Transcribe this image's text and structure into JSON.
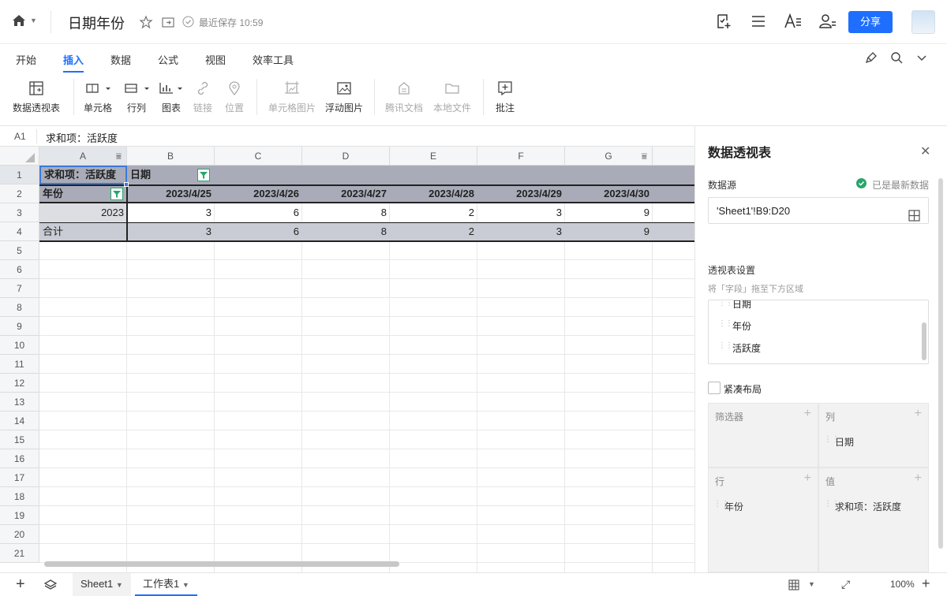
{
  "header": {
    "title": "日期年份",
    "save_status": "最近保存 10:59",
    "share_label": "分享"
  },
  "menu": {
    "tabs": [
      "开始",
      "插入",
      "数据",
      "公式",
      "视图",
      "效率工具"
    ]
  },
  "toolbar": {
    "items": [
      "数据透视表",
      "单元格",
      "行列",
      "图表",
      "链接",
      "位置",
      "单元格图片",
      "浮动图片",
      "腾讯文档",
      "本地文件",
      "批注"
    ]
  },
  "formula": {
    "cell_ref": "A1",
    "value": "求和项：活跃度"
  },
  "grid": {
    "columns": [
      "A",
      "B",
      "C",
      "D",
      "E",
      "F",
      "G"
    ],
    "rows": [
      "1",
      "2",
      "3",
      "4",
      "5",
      "6",
      "7",
      "8",
      "9",
      "10",
      "11",
      "12",
      "13",
      "14",
      "15",
      "16",
      "17",
      "18",
      "19",
      "20",
      "21"
    ],
    "r1": {
      "a": "求和项：活跃度",
      "b": "日期"
    },
    "r2": {
      "a": "年份",
      "dates": [
        "2023/4/25",
        "2023/4/26",
        "2023/4/27",
        "2023/4/28",
        "2023/4/29",
        "2023/4/30"
      ]
    },
    "r3": {
      "a": "2023",
      "values": [
        "3",
        "6",
        "8",
        "2",
        "3",
        "9"
      ]
    },
    "r4": {
      "a": "合计",
      "values": [
        "3",
        "6",
        "8",
        "2",
        "3",
        "9"
      ]
    }
  },
  "panel": {
    "title": "数据透视表",
    "source_label": "数据源",
    "source_status": "已是最新数据",
    "source_value": "'Sheet1'!B9:D20",
    "settings_label": "透视表设置",
    "settings_hint": "将「字段」拖至下方区域",
    "fields": [
      "日期",
      "年份",
      "活跃度"
    ],
    "compact_label": "紧凑布局",
    "zones": {
      "filter": "筛选器",
      "col": "列",
      "col_item": "日期",
      "row": "行",
      "row_item": "年份",
      "val": "值",
      "val_item": "求和项：活跃度"
    }
  },
  "sheets": {
    "tabs": [
      "Sheet1",
      "工作表1"
    ],
    "zoom": "100%"
  }
}
